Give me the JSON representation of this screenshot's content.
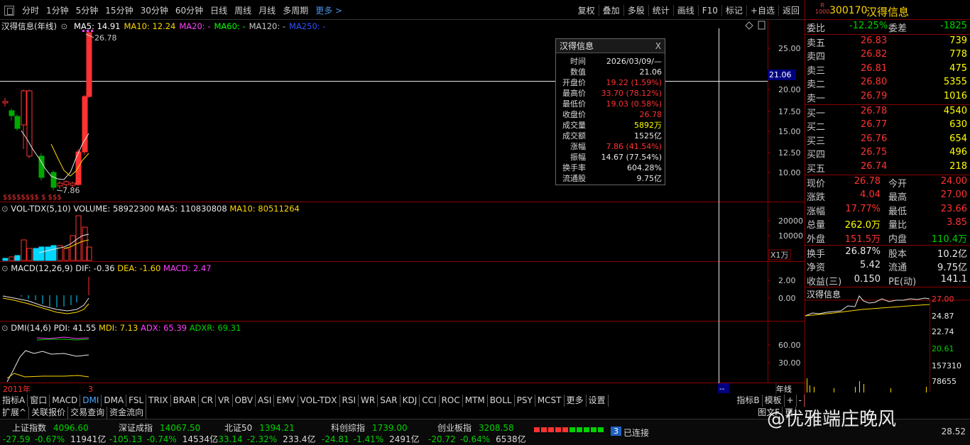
{
  "toolbar": {
    "left": [
      "分时",
      "1分钟",
      "5分钟",
      "15分钟",
      "30分钟",
      "60分钟",
      "日线",
      "周线",
      "月线",
      "多周期"
    ],
    "more_label": "更多 >",
    "right": [
      "复权",
      "叠加",
      "多股",
      "统计",
      "画线",
      "F10",
      "标记",
      "+自选",
      "返回"
    ]
  },
  "kline": {
    "title": "汉得信息(年线)",
    "ma_labels": [
      {
        "text": "MA5: 14.91",
        "color": "#ffffff"
      },
      {
        "text": "MA10: 12.24",
        "color": "#ffd700"
      },
      {
        "text": "MA20: -",
        "color": "#ff40ff"
      },
      {
        "text": "MA60: -",
        "color": "#00ff00"
      },
      {
        "text": "MA120: -",
        "color": "#c8c8c8"
      },
      {
        "text": "MA250: -",
        "color": "#3050ff"
      }
    ],
    "high_marker": "26.78",
    "low_marker": "7.86",
    "y_ticks": [
      "25.00",
      "20.00",
      "17.50",
      "15.00",
      "12.50",
      "10.00"
    ],
    "crosshair_value": "21.06",
    "s_markers": "$$$$$$$$  $  $$$"
  },
  "volume": {
    "title": "VOL-TDX(5,10)",
    "values_text": "VOLUME: 58922300",
    "ma5_text": "MA5: 110830808",
    "ma10_text": "MA10: 80511264",
    "y_ticks": [
      "20000",
      "10000"
    ],
    "unit": "X1万"
  },
  "macd": {
    "title": "MACD(12,26,9)",
    "dif_text": "DIF: -0.36",
    "dea_text": "DEA: -1.60",
    "macd_text": "MACD: 2.47",
    "y_ticks": [
      "2.00",
      "0.00"
    ]
  },
  "dmi": {
    "title": "DMI(14,6)",
    "pdi_text": "PDI: 41.55",
    "mdi_text": "MDI: 7.13",
    "adx_text": "ADX: 65.39",
    "adxr_text": "ADXR: 69.31",
    "y_ticks": [
      "60.00",
      "30.00"
    ]
  },
  "axis": {
    "year_label": "2011年",
    "period_label": "3",
    "axis_end_marker": "--",
    "right_label": "年线"
  },
  "popup": {
    "title": "汉得信息",
    "close": "X",
    "rows": [
      {
        "label": "时间",
        "value": "2026/03/09/—",
        "color": "#e8e8e8"
      },
      {
        "label": "数值",
        "value": "21.06",
        "color": "#e8e8e8"
      },
      {
        "label": "开盘价",
        "value": "19.22 (1.59%)",
        "color": "#ff3232"
      },
      {
        "label": "最高价",
        "value": "33.70 (78.12%)",
        "color": "#ff3232"
      },
      {
        "label": "最低价",
        "value": "19.03 (0.58%)",
        "color": "#ff3232"
      },
      {
        "label": "收盘价",
        "value": "26.78",
        "color": "#ff3232"
      },
      {
        "label": "成交量",
        "value": "5892万",
        "color": "#ffff00"
      },
      {
        "label": "成交额",
        "value": "1525亿",
        "color": "#e8e8e8"
      },
      {
        "label": "涨幅",
        "value": "7.86 (41.54%)",
        "color": "#ff3232"
      },
      {
        "label": "振幅",
        "value": "14.67 (77.54%)",
        "color": "#e8e8e8"
      },
      {
        "label": "换手率",
        "value": "604.28%",
        "color": "#e8e8e8"
      },
      {
        "label": "流通股",
        "value": "9.75亿",
        "color": "#e8e8e8"
      }
    ]
  },
  "quote": {
    "badge_top": "R",
    "badge_bottom": "1000",
    "code": "300170",
    "name": "汉得信息",
    "weibi": {
      "label": "委比",
      "value": "-12.25%",
      "label2": "委差",
      "value2": "-1825"
    },
    "sell": [
      {
        "label": "卖五",
        "price": "26.83",
        "vol": "739"
      },
      {
        "label": "卖四",
        "price": "26.82",
        "vol": "778"
      },
      {
        "label": "卖三",
        "price": "26.81",
        "vol": "475"
      },
      {
        "label": "卖二",
        "price": "26.80",
        "vol": "5355"
      },
      {
        "label": "卖一",
        "price": "26.79",
        "vol": "1016"
      }
    ],
    "buy": [
      {
        "label": "买一",
        "price": "26.78",
        "vol": "4540"
      },
      {
        "label": "买二",
        "price": "26.77",
        "vol": "630"
      },
      {
        "label": "买三",
        "price": "26.76",
        "vol": "654"
      },
      {
        "label": "买四",
        "price": "26.75",
        "vol": "496"
      },
      {
        "label": "买五",
        "price": "26.74",
        "vol": "218"
      }
    ],
    "stats": [
      {
        "l1": "现价",
        "v1": "26.78",
        "c1": "red",
        "l2": "今开",
        "v2": "24.00",
        "c2": "red"
      },
      {
        "l1": "涨跌",
        "v1": "4.04",
        "c1": "red",
        "l2": "最高",
        "v2": "27.00",
        "c2": "red"
      },
      {
        "l1": "涨幅",
        "v1": "17.77%",
        "c1": "red",
        "l2": "最低",
        "v2": "23.66",
        "c2": "red"
      },
      {
        "l1": "总量",
        "v1": "262.0万",
        "c1": "yellow",
        "l2": "量比",
        "v2": "3.85",
        "c2": "red"
      },
      {
        "l1": "外盘",
        "v1": "151.5万",
        "c1": "red",
        "l2": "内盘",
        "v2": "110.4万",
        "c2": "green"
      }
    ],
    "stats2": [
      {
        "l1": "换手",
        "v1": "26.87%",
        "l2": "股本",
        "v2": "10.2亿"
      },
      {
        "l1": "净资",
        "v1": "5.42",
        "l2": "流通",
        "v2": "9.75亿"
      },
      {
        "l1": "收益(三)",
        "v1": "0.150",
        "l2": "PE(动)",
        "v2": "141.1"
      }
    ],
    "mini_title": "汉得信息",
    "mini_ticks": [
      "27.00",
      "24.87",
      "22.74",
      "20.61",
      "157310",
      "78655"
    ]
  },
  "tabs": [
    "指标A",
    "窗口",
    "MACD",
    "DMI",
    "DMA",
    "FSL",
    "TRIX",
    "BRAR",
    "CR",
    "VR",
    "OBV",
    "ASI",
    "EMV",
    "VOL-TDX",
    "RSI",
    "WR",
    "SAR",
    "KDJ",
    "CCI",
    "ROC",
    "MTM",
    "BOLL",
    "PSY",
    "MCST",
    "更多",
    "设置"
  ],
  "tabs_right": [
    "指标B",
    "模板",
    "+",
    "-"
  ],
  "ext_tabs": [
    "扩展^",
    "关联报价",
    "交易查询",
    "资金流向"
  ],
  "ext_right": [
    "图文F",
    "更"
  ],
  "status": {
    "indices": [
      {
        "name": "上证指数",
        "value": "4096.60",
        "chg": "-27.59",
        "pct": "-0.67%",
        "amt": "11941亿"
      },
      {
        "name": "深证成指",
        "value": "14067.50",
        "chg": "-105.13",
        "pct": "-0.74%",
        "amt": "14534亿"
      },
      {
        "name": "北证50",
        "value": "1394.21",
        "chg": "-33.14",
        "pct": "-2.32%",
        "amt": "233.4亿"
      },
      {
        "name": "科创综指",
        "value": "1739.00",
        "chg": "-24.81",
        "pct": "-1.41%",
        "amt": "2491亿"
      },
      {
        "name": "创业板指",
        "value": "3208.58",
        "chg": "-20.72",
        "pct": "-0.64%",
        "amt": "6538亿"
      }
    ],
    "conn_badge": "3",
    "conn_text": "已连接",
    "clock": "28.52"
  },
  "watermark": "@优雅端庄晚风"
}
